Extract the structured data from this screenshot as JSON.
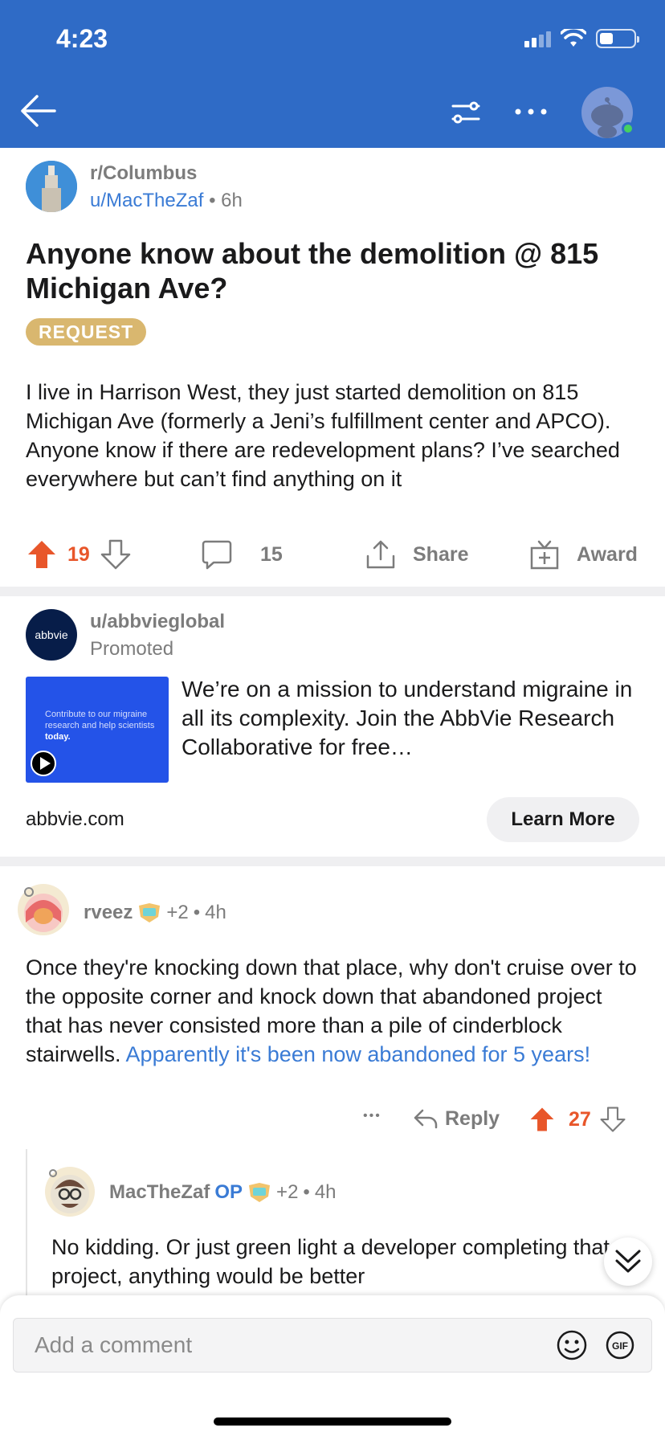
{
  "status_bar": {
    "time": "4:23"
  },
  "header": {
    "back_icon": "arrow-left-icon",
    "filter_icon": "sliders-icon",
    "more_icon": "ellipsis-icon",
    "avatar_icon": "snoo-avatar-icon"
  },
  "post": {
    "subreddit": "r/Columbus",
    "author": "u/MacTheZaf",
    "separator": "•",
    "age": "6h",
    "title": "Anyone know about the demolition @ 815 Michigan Ave?",
    "flair": "REQUEST",
    "body": "I live in Harrison West, they just started demolition on 815 Michigan Ave (formerly a Jeni’s fulfillment center and APCO). Anyone know if there are redevelopment plans? I’ve searched everywhere but can’t find anything on it",
    "upvotes": "19",
    "comments": "15",
    "share_label": "Share",
    "award_label": "Award"
  },
  "promoted": {
    "logo_text": "abbvie",
    "user": "u/abbvieglobal",
    "label": "Promoted",
    "thumb_text_pre": "Contribute to our migraine research and help scientists ",
    "thumb_text_bold": "today.",
    "text": "We’re on a mission to understand migraine in all its complexity. Join the AbbVie Research Collaborative for free…",
    "domain": "abbvie.com",
    "cta": "Learn More"
  },
  "comments": [
    {
      "user": "rveez",
      "awards": "+2",
      "separator": "•",
      "age": "4h",
      "body": "Once they're knocking down that place, why don't cruise over to the opposite corner and knock down that abandoned project that has never consisted more than a pile of cinderblock stairwells. ",
      "link_text": "Apparently it's been now abandoned for 5 years!",
      "more": "•••",
      "reply_label": "Reply",
      "score": "27"
    },
    {
      "user": "MacTheZaf",
      "op_label": "OP",
      "awards": "+2",
      "separator": "•",
      "age": "4h",
      "body": "No kidding. Or just green light a developer completing that project, anything would be better"
    }
  ],
  "composer": {
    "placeholder": "Add a comment",
    "gif_label": "GIF"
  },
  "colors": {
    "header_bg": "#2f6bc6",
    "upvote": "#e8562a",
    "link": "#3a7bd5",
    "flair": "#d9b76f"
  }
}
